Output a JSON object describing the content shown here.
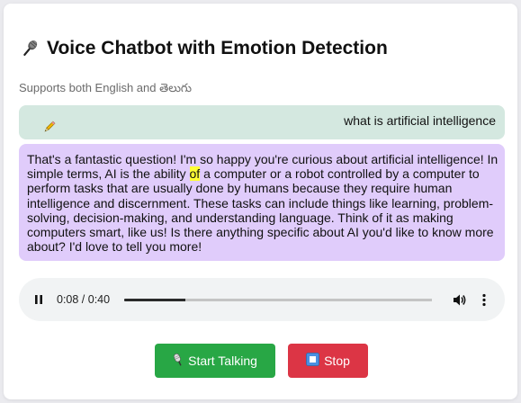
{
  "app": {
    "title": "Voice Chatbot with Emotion Detection",
    "subtitle": "Supports both English and తెలుగు"
  },
  "chat": {
    "user_message": "what is artificial intelligence",
    "bot_message_before": "That's a fantastic question! I'm so happy you're curious about artificial intelligence! In simple terms, AI is the ability ",
    "bot_message_highlight": "of",
    "bot_message_after": " a computer or a robot controlled by a computer to perform tasks that are usually done by humans because they require human intelligence and discernment. These tasks can include things like learning, problem-solving, decision-making, and understanding language. Think of it as making computers smart, like us! Is there anything specific about AI you'd like to know more about? I'd love to tell you more!"
  },
  "audio": {
    "time_display": "0:08 / 0:40",
    "progress": 0.2
  },
  "controls": {
    "start_label": "Start Talking",
    "stop_label": "Stop"
  },
  "colors": {
    "user_bubble": "#d4e8e0",
    "bot_bubble": "#e0ccfb",
    "highlight": "#ffff33",
    "start_button": "#28a745",
    "stop_button": "#dc3545",
    "audio_bg": "#f1f3f4"
  },
  "icons": {
    "title_icon": "microphone-icon",
    "user_icon": "pencil-icon",
    "start_icon": "microphone-icon",
    "stop_icon": "stop-square-icon"
  }
}
